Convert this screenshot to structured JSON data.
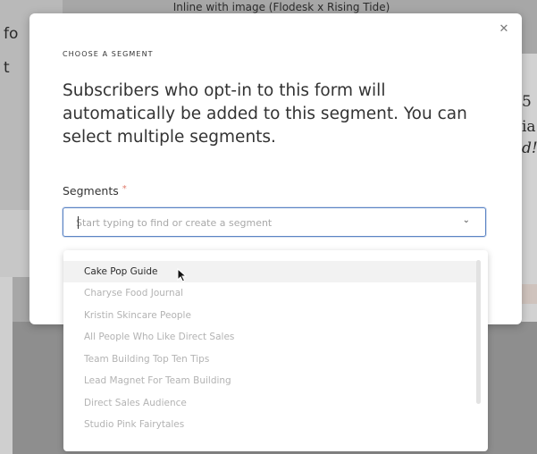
{
  "background": {
    "title": "Inline with image (Flodesk x Rising Tide)",
    "left_fragments": [
      "fo",
      "t"
    ],
    "right_fragments": [
      "5",
      "ia",
      "d!"
    ]
  },
  "modal": {
    "eyebrow": "CHOOSE A SEGMENT",
    "heading": "Subscribers who opt-in to this form will automatically be added to this segment. You can select multiple segments.",
    "close_icon": "close-icon",
    "field": {
      "label": "Segments",
      "required_mark": "*",
      "placeholder": "Start typing to find or create a segment",
      "value": ""
    }
  },
  "dropdown": {
    "options": [
      "Cake Pop Guide",
      "Charyse Food Journal",
      "Kristin Skincare People",
      "All People Who Like Direct Sales",
      "Team Building Top Ten Tips",
      "Lead Magnet For Team Building",
      "Direct Sales Audience",
      "Studio Pink Fairytales"
    ],
    "active_index": 0
  },
  "colors": {
    "accent_border": "#5b84c4",
    "required": "#e07b6b",
    "option_muted": "#b3b3b3",
    "option_active": "#2b2b2b"
  }
}
